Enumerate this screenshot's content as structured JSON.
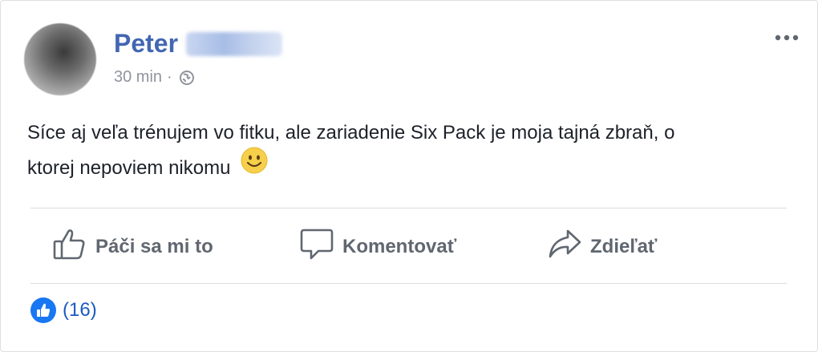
{
  "post": {
    "author_first_name": "Peter",
    "timestamp": "30 min",
    "separator": "·",
    "audience_icon": "globe-icon",
    "text_line1": "Síce aj veľa trénujem vo fitku, ale zariadenie Six Pack je moja tajná zbraň, o",
    "text_line2": "ktorej nepoviem nikomu",
    "emoji": "smiley-emoji"
  },
  "actions": {
    "like_label": "Páči sa mi to",
    "comment_label": "Komentovať",
    "share_label": "Zdieľať"
  },
  "reactions": {
    "count": "(16)",
    "icon": "like-icon"
  },
  "colors": {
    "name": "#4267b2",
    "text": "#1d2129",
    "muted": "#90949c",
    "action": "#606770",
    "like_blue": "#1877f2"
  }
}
